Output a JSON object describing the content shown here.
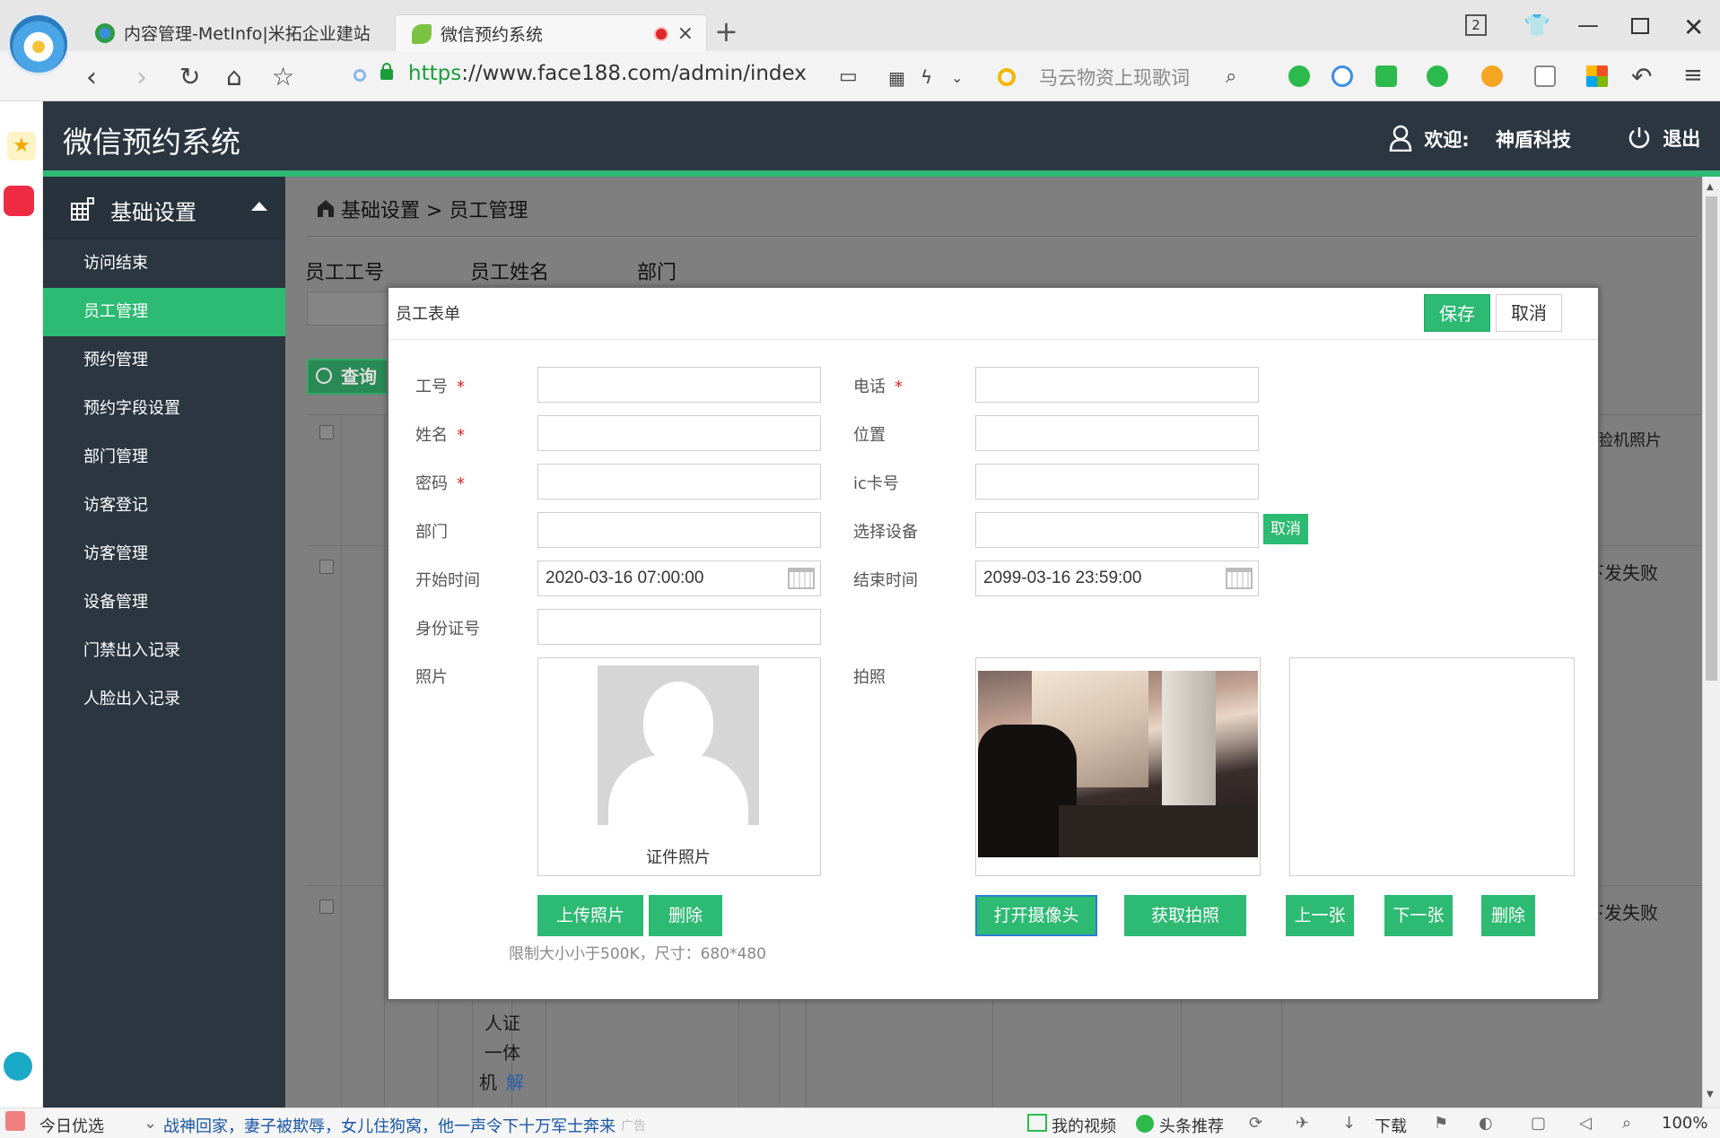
{
  "browser": {
    "tabs": [
      {
        "title": "内容管理-MetInfo|米拓企业建站"
      },
      {
        "title": "微信预约系统"
      }
    ],
    "tab_count": "2",
    "url_scheme": "https",
    "url_rest": "://www.face188.com/admin/index",
    "search_placeholder": "马云物资上现歌词",
    "statusbar": {
      "today": "今日优选",
      "headline": "战神回家，妻子被欺辱，女儿住狗窝，他一声令下十万军士奔来",
      "ad": "广告",
      "my_video": "我的视频",
      "top_news": "头条推荐",
      "download": "下载",
      "zoom": "100%"
    }
  },
  "app": {
    "title": "微信预约系统",
    "welcome": "欢迎:",
    "user": "神盾科技",
    "logout": "退出",
    "accent": "#2dba73",
    "header_bg": "#2b3641"
  },
  "sidebar": {
    "section": "基础设置",
    "items": [
      {
        "label": "访问结束"
      },
      {
        "label": "员工管理"
      },
      {
        "label": "预约管理"
      },
      {
        "label": "预约字段设置"
      },
      {
        "label": "部门管理"
      },
      {
        "label": "访客登记"
      },
      {
        "label": "访客管理"
      },
      {
        "label": "设备管理"
      },
      {
        "label": "门禁出入记录"
      },
      {
        "label": "人脸出入记录"
      }
    ]
  },
  "page": {
    "breadcrumb": "基础设置 > 员工管理",
    "filters": {
      "emp_no": "员工工号",
      "emp_name": "员工姓名",
      "dept": "部门"
    },
    "query": "查询",
    "bg_col_face_photo": "脸机照片",
    "bg_status_1": "下发失败",
    "bg_status_2": "下发失败",
    "bg_cell_lines": [
      "人证",
      "一体",
      "机",
      "解"
    ]
  },
  "modal": {
    "title": "员工表单",
    "save": "保存",
    "cancel": "取消",
    "fields": {
      "emp_no": {
        "label": "工号",
        "required": "*",
        "value": ""
      },
      "name": {
        "label": "姓名",
        "required": "*",
        "value": ""
      },
      "password": {
        "label": "密码",
        "required": "*",
        "value": ""
      },
      "dept": {
        "label": "部门",
        "value": ""
      },
      "start_time": {
        "label": "开始时间",
        "value": "2020-03-16 07:00:00"
      },
      "id_card": {
        "label": "身份证号",
        "value": ""
      },
      "photo": {
        "label": "照片"
      },
      "phone": {
        "label": "电话",
        "required": "*",
        "value": ""
      },
      "position": {
        "label": "位置",
        "value": ""
      },
      "ic_card": {
        "label": "ic卡号",
        "value": ""
      },
      "device": {
        "label": "选择设备",
        "value": "",
        "cancel": "取消"
      },
      "end_time": {
        "label": "结束时间",
        "value": "2099-03-16 23:59:00"
      },
      "capture": {
        "label": "拍照"
      }
    },
    "id_photo_caption": "证件照片",
    "buttons": {
      "upload": "上传照片",
      "delete_photo": "删除",
      "open_camera": "打开摄像头",
      "take_photo": "获取拍照",
      "prev": "上一张",
      "next": "下一张",
      "delete_capture": "删除"
    },
    "upload_hint": "限制大小小于500K，尺寸：680*480"
  }
}
